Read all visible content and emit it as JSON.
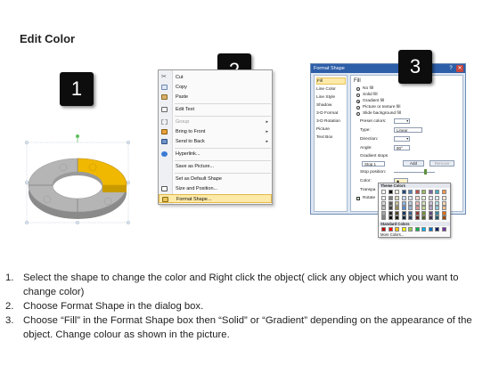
{
  "title": "Edit Color",
  "steps": [
    "1",
    "2",
    "3"
  ],
  "context_menu": {
    "items": [
      {
        "label": "Cut",
        "icon": "scissors-icon"
      },
      {
        "label": "Copy",
        "icon": "copy-icon"
      },
      {
        "label": "Paste",
        "icon": "paste-icon"
      },
      {
        "label": "Edit Text",
        "icon": "edit-text-icon"
      },
      {
        "label": "Group",
        "icon": "group-icon",
        "disabled": true,
        "submenu": true
      },
      {
        "label": "Bring to Front",
        "icon": "bring-front-icon",
        "submenu": true
      },
      {
        "label": "Send to Back",
        "icon": "send-back-icon",
        "submenu": true
      },
      {
        "label": "Hyperlink...",
        "icon": "hyperlink-icon"
      },
      {
        "label": "Save as Picture...",
        "icon": ""
      },
      {
        "label": "Set as Default Shape",
        "icon": ""
      },
      {
        "label": "Size and Position...",
        "icon": "size-position-icon"
      },
      {
        "label": "Format Shape...",
        "icon": "format-shape-icon",
        "highlighted": true
      }
    ]
  },
  "format_dialog": {
    "title": "Format Shape",
    "sidebar": [
      "Fill",
      "Line Color",
      "Line Style",
      "Shadow",
      "3-D Format",
      "3-D Rotation",
      "Picture",
      "Text Box"
    ],
    "fill_header": "Fill",
    "options": [
      "No fill",
      "Solid fill",
      "Gradient fill",
      "Picture or texture fill",
      "Slide background fill"
    ],
    "fields": {
      "preset_colors": "Preset colors:",
      "type_label": "Type:",
      "type_value": "Linear",
      "direction_label": "Direction:",
      "angle_label": "Angle:",
      "angle_value": "90°",
      "gradient_stops": "Gradient stops",
      "stop_value": "Stop 1",
      "add_button": "Add",
      "remove_button": "Remove",
      "stop_position": "Stop position:",
      "color_label": "Color:",
      "transparency_label": "Transpa",
      "rotate_label": "Rotate"
    },
    "palette": {
      "theme_header": "Theme Colors",
      "standard_header": "Standard Colors",
      "more": "More Colors...",
      "theme_top": [
        "#ffffff",
        "#000000",
        "#eeece1",
        "#1f497d",
        "#4f81bd",
        "#c0504d",
        "#9bbb59",
        "#8064a2",
        "#4bacc6",
        "#f79646"
      ],
      "theme_columns": [
        [
          "#f2f2f2",
          "#d9d9d9",
          "#bfbfbf",
          "#a6a6a6",
          "#808080"
        ],
        [
          "#7f7f7f",
          "#595959",
          "#404040",
          "#262626",
          "#0d0d0d"
        ],
        [
          "#ddd9c3",
          "#c4bd97",
          "#948a54",
          "#4a452a",
          "#1e1c11"
        ],
        [
          "#c6d9f1",
          "#8db3e2",
          "#548dd4",
          "#17365d",
          "#0f243e"
        ],
        [
          "#dbe5f1",
          "#b8cce4",
          "#95b3d7",
          "#366092",
          "#244061"
        ],
        [
          "#f2dcdb",
          "#e6b9b8",
          "#d99694",
          "#953735",
          "#632523"
        ],
        [
          "#ebf1dd",
          "#d7e4bd",
          "#c3d69b",
          "#77933c",
          "#4f6228"
        ],
        [
          "#e5e0ec",
          "#ccc1da",
          "#b3a2c7",
          "#604a7b",
          "#403152"
        ],
        [
          "#dbeef4",
          "#b7dde8",
          "#92cddc",
          "#31859c",
          "#215968"
        ],
        [
          "#fdeada",
          "#fbd5b5",
          "#fac08f",
          "#e46c0a",
          "#984807"
        ]
      ],
      "standard": [
        "#c00000",
        "#ff0000",
        "#ffc000",
        "#ffff00",
        "#92d050",
        "#00b050",
        "#00b0f0",
        "#0070c0",
        "#002060",
        "#7030a0"
      ]
    }
  },
  "shape": {
    "accent_color": "#f0b800",
    "base_color": "#a8a8a8"
  },
  "instructions": [
    {
      "num": "1.",
      "text": "Select the shape to change the color and Right click the object( click any object which you want to change color)"
    },
    {
      "num": "2.",
      "text": "Choose Format Shape in the dialog box."
    },
    {
      "num": "3.",
      "text": "Choose “Fill” in the Format Shape box then “Solid” or “Gradient” depending on the appearance of the object. Change colour as shown in the picture."
    }
  ]
}
